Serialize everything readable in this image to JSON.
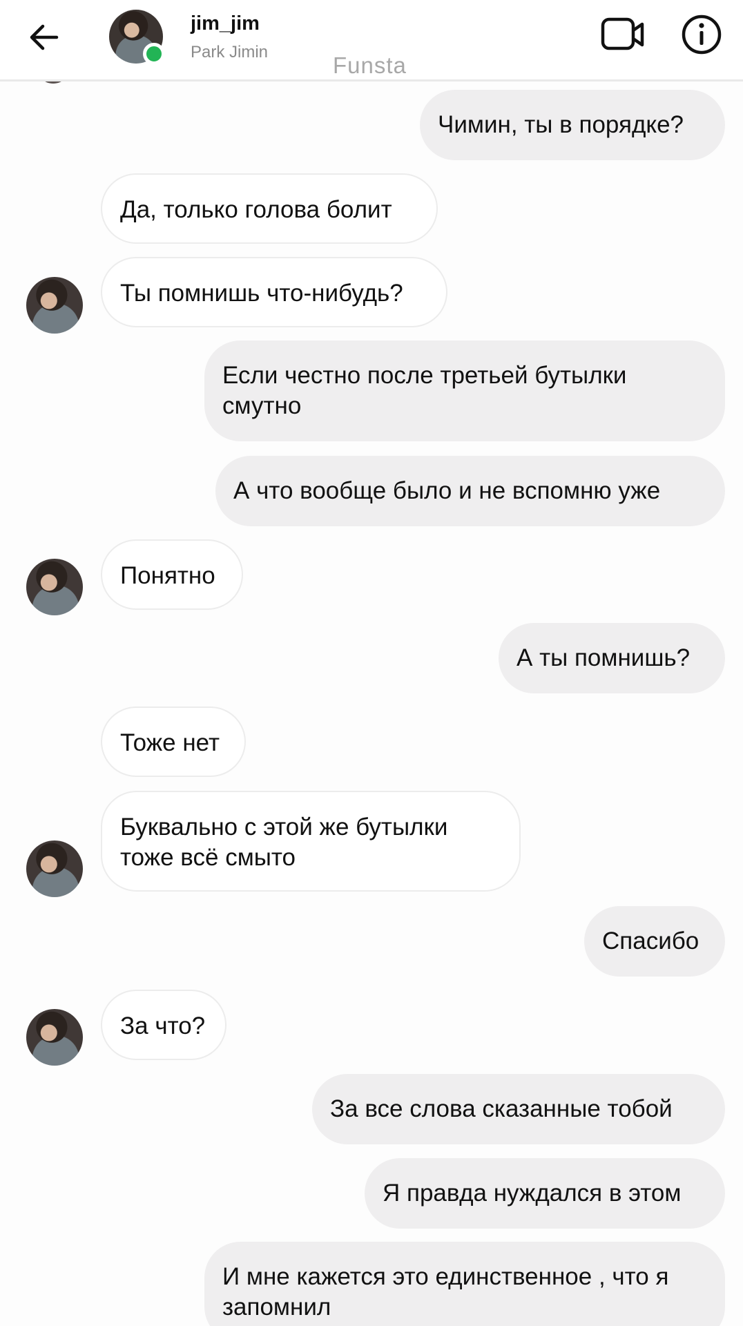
{
  "header": {
    "username": "jim_jim",
    "full_name": "Park Jimin",
    "watermark": "Funsta",
    "online": true,
    "icons": {
      "back": "back-arrow-icon",
      "video": "video-call-icon",
      "info": "info-icon"
    }
  },
  "messages": [
    {
      "side": "out",
      "text": "Чимин, ты в порядке?"
    },
    {
      "side": "in",
      "text": "Да, только голова болит",
      "avatar": false
    },
    {
      "side": "in",
      "text": "Ты помнишь что-нибудь?",
      "avatar": true
    },
    {
      "side": "out",
      "text": "Если честно после третьей бутылки смутно"
    },
    {
      "side": "out",
      "text": "А что вообще было и не вспомню уже"
    },
    {
      "side": "in",
      "text": "Понятно",
      "avatar": true
    },
    {
      "side": "out",
      "text": "А ты помнишь?"
    },
    {
      "side": "in",
      "text": "Тоже нет",
      "avatar": false
    },
    {
      "side": "in",
      "text": "Буквально с этой же бутылки тоже всё смыто",
      "avatar": true
    },
    {
      "side": "out",
      "text": "Спасибо"
    },
    {
      "side": "in",
      "text": "За что?",
      "avatar": true
    },
    {
      "side": "out",
      "text": "За все слова сказанные тобой"
    },
    {
      "side": "out",
      "text": "Я правда нуждался в этом"
    },
    {
      "side": "out",
      "text": "И мне кажется это единственное , что я запомнил"
    }
  ],
  "colors": {
    "online": "#22b455",
    "outgoing_bubble": "#efeeef",
    "incoming_border": "#ececec"
  }
}
